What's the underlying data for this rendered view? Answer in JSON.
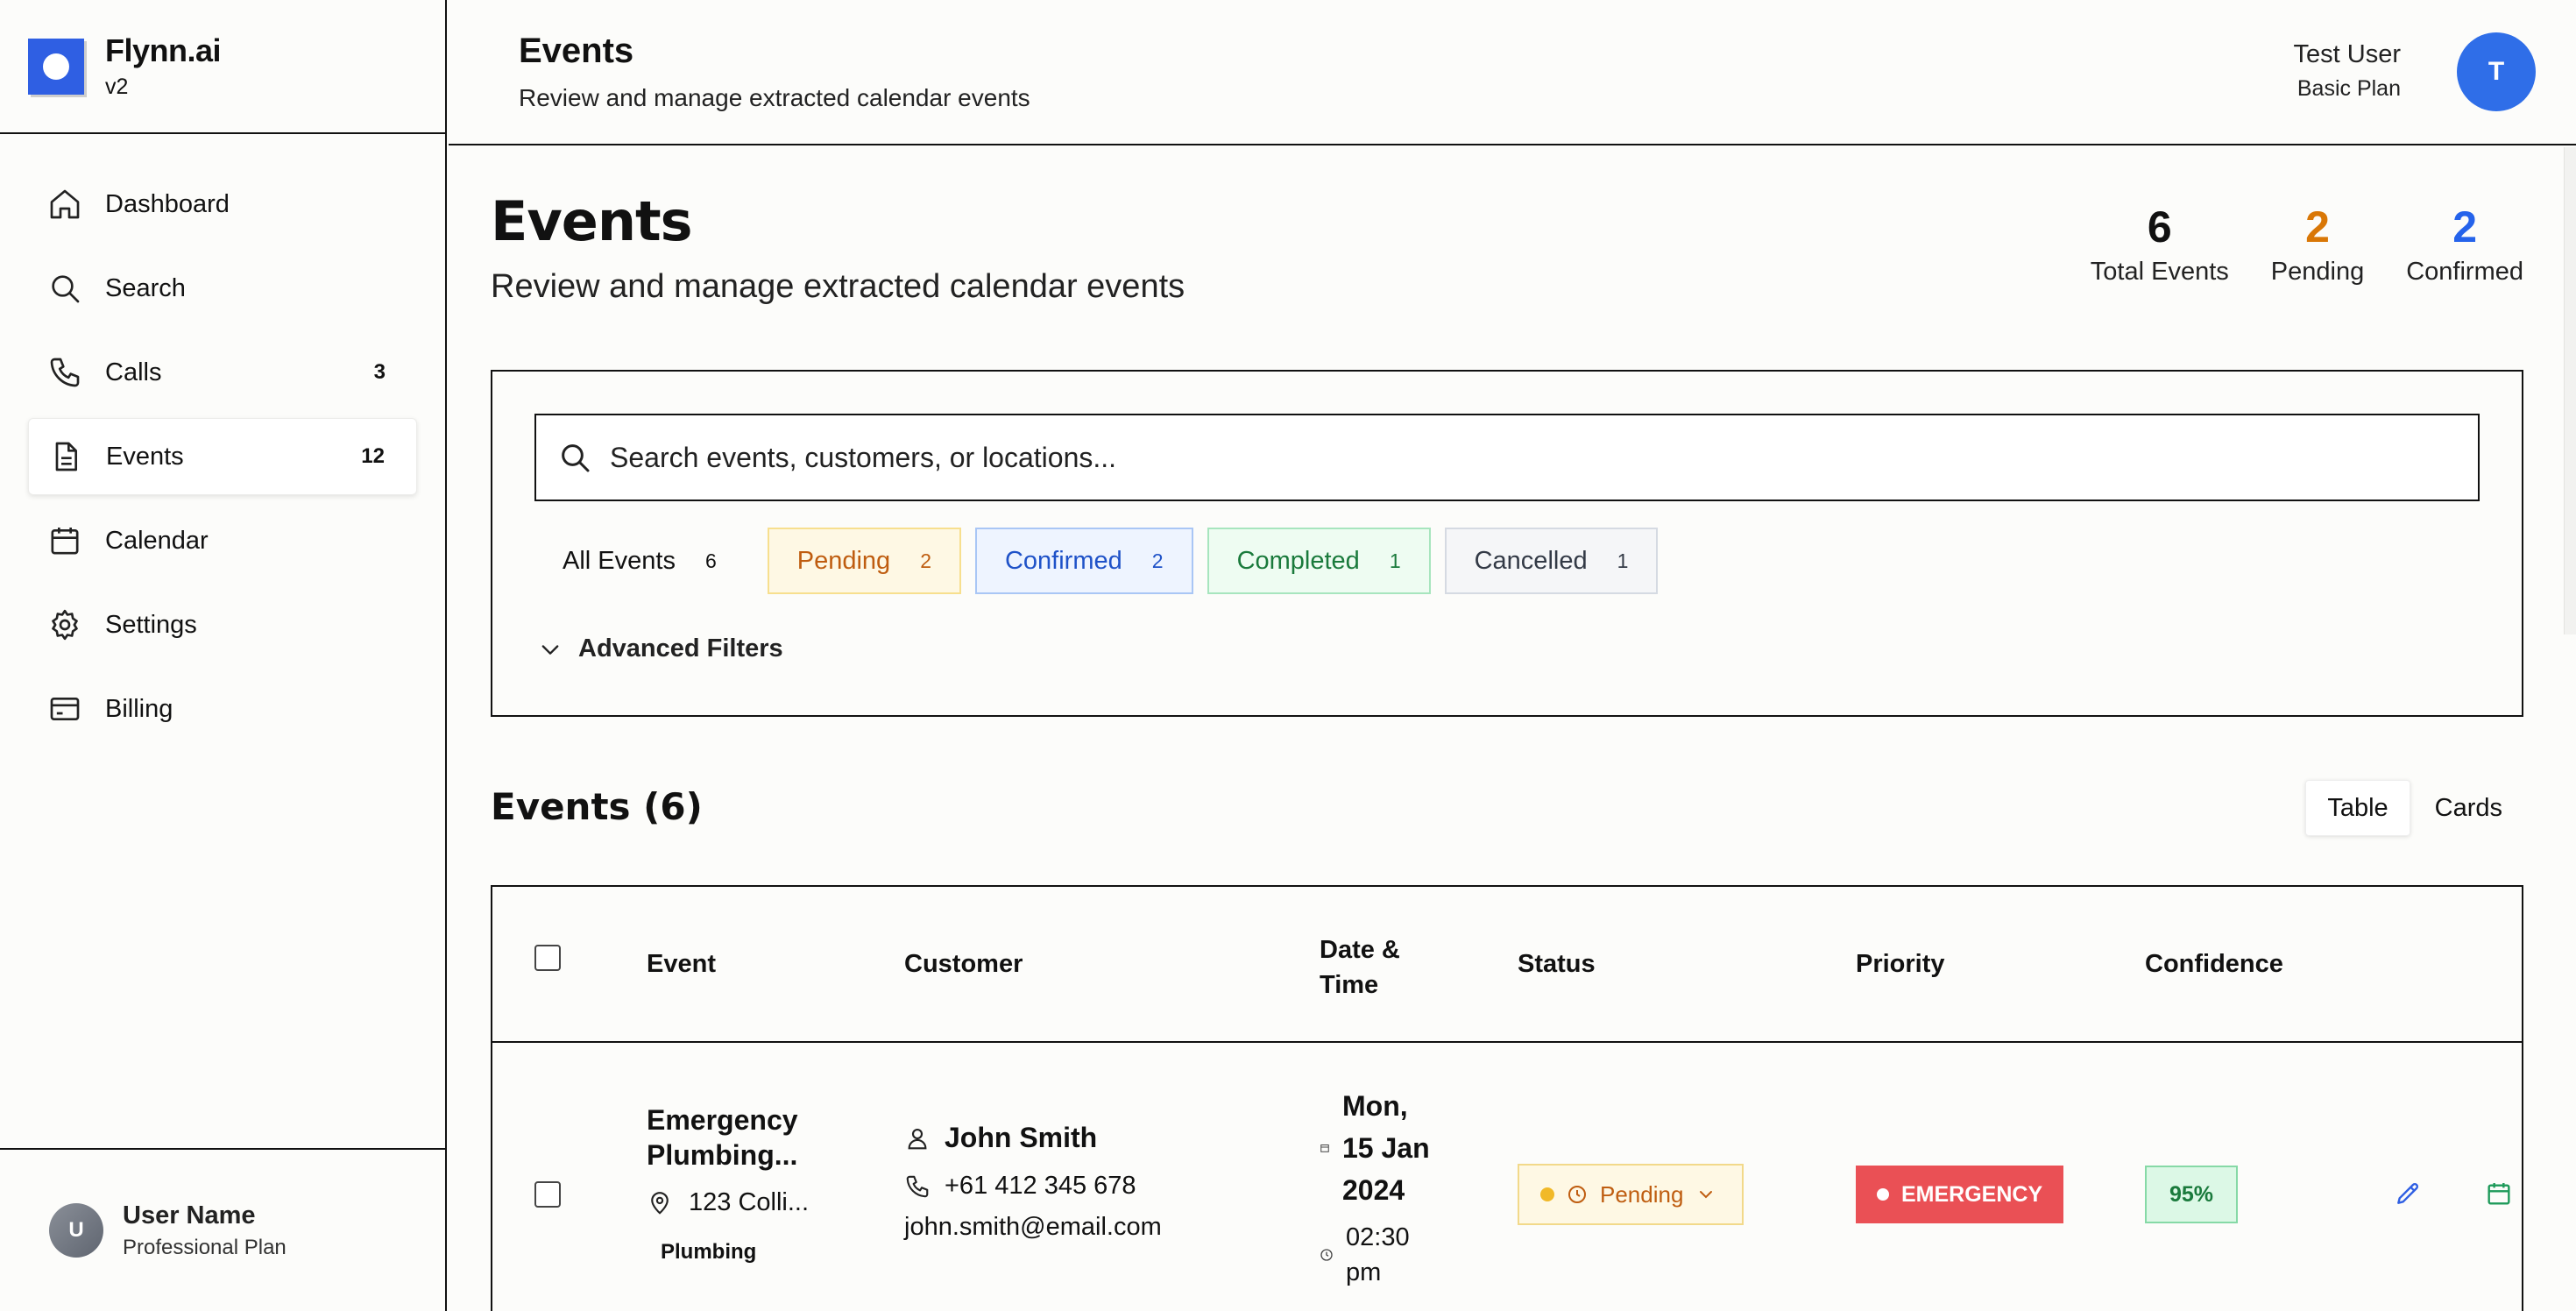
{
  "brand": {
    "name": "Flynn.ai",
    "version": "v2",
    "accent": "#2f5fe3"
  },
  "sidebar": {
    "items": [
      {
        "label": "Dashboard",
        "icon": "home-icon",
        "badge": ""
      },
      {
        "label": "Search",
        "icon": "search-icon",
        "badge": ""
      },
      {
        "label": "Calls",
        "icon": "phone-icon",
        "badge": "3"
      },
      {
        "label": "Events",
        "icon": "document-icon",
        "badge": "12",
        "active": true
      },
      {
        "label": "Calendar",
        "icon": "calendar-icon",
        "badge": ""
      },
      {
        "label": "Settings",
        "icon": "gear-icon",
        "badge": ""
      },
      {
        "label": "Billing",
        "icon": "credit-card-icon",
        "badge": ""
      }
    ],
    "user": {
      "initial": "U",
      "name": "User Name",
      "plan": "Professional Plan"
    }
  },
  "topbar": {
    "title": "Events",
    "subtitle": "Review and manage extracted calendar events",
    "user_name": "Test User",
    "user_plan": "Basic Plan",
    "user_initial": "T"
  },
  "page": {
    "title": "Events",
    "subtitle": "Review and manage extracted calendar events",
    "stats": [
      {
        "value": "6",
        "label": "Total Events",
        "color": "#111111"
      },
      {
        "value": "2",
        "label": "Pending",
        "color": "#d97706"
      },
      {
        "value": "2",
        "label": "Confirmed",
        "color": "#2563eb"
      }
    ]
  },
  "filters": {
    "search_placeholder": "Search events, customers, or locations...",
    "chips": [
      {
        "label": "All Events",
        "count": "6",
        "kind": "all"
      },
      {
        "label": "Pending",
        "count": "2",
        "kind": "pending"
      },
      {
        "label": "Confirmed",
        "count": "2",
        "kind": "confirmed"
      },
      {
        "label": "Completed",
        "count": "1",
        "kind": "completed"
      },
      {
        "label": "Cancelled",
        "count": "1",
        "kind": "cancelled"
      }
    ],
    "advanced_label": "Advanced Filters"
  },
  "events_list": {
    "heading": "Events (6)",
    "views": [
      "Table",
      "Cards"
    ],
    "active_view": "Table",
    "columns": [
      "Event",
      "Customer",
      "Date &",
      "Time",
      "Status",
      "Priority",
      "Confidence"
    ],
    "rows": [
      {
        "title_line1": "Emergency",
        "title_line2": "Plumbing...",
        "location": "123 Colli...",
        "category": "Plumbing",
        "customer_name": "John Smith",
        "customer_phone": "+61 412 345 678",
        "customer_email": "john.smith@email.com",
        "date_line1": "Mon,",
        "date_line2": "15 Jan",
        "date_line3": "2024",
        "time_line1": "02:30",
        "time_line2": "pm",
        "status": "Pending",
        "priority": "EMERGENCY",
        "confidence": "95%"
      }
    ]
  }
}
